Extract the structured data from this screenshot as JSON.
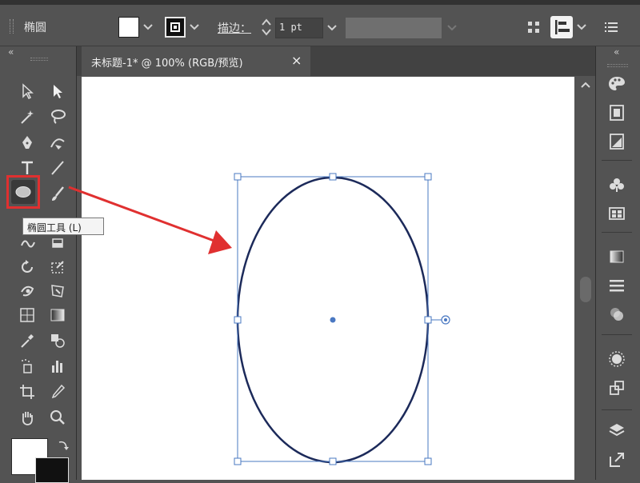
{
  "control_bar": {
    "object_type": "椭圆",
    "fill_color": "#ffffff",
    "stroke_label": "描边：",
    "stroke_weight": "1 pt",
    "icons": [
      "fill-swatch",
      "stroke-swatch",
      "stroke-weight-stepper",
      "align-grid-icon",
      "align-left-icon",
      "menu-icon"
    ]
  },
  "document_tab": {
    "title": "未标题-1* @ 100% (RGB/预览)",
    "close_glyph": "×"
  },
  "panel_collapse_glyph": "«",
  "tooltip": {
    "text": "椭圆工具 (L)"
  },
  "colors": {
    "ui_background": "#535353",
    "tab_bar": "#424242",
    "artboard": "#ffffff",
    "selection_blue": "#4a78c2",
    "ellipse_stroke": "#1c2a5a",
    "highlight_red": "#e03030"
  },
  "tools_left": [
    "selection-tool-icon",
    "direct-selection-tool-icon",
    "magic-wand-tool-icon",
    "lasso-tool-icon",
    "pen-tool-icon",
    "curvature-tool-icon",
    "type-tool-icon",
    "line-segment-tool-icon",
    "ellipse-tool-icon",
    "paintbrush-tool-icon",
    "shaper-tool-icon",
    "eraser-tool-icon",
    "rotate-tool-icon",
    "scale-tool-icon",
    "warp-tool-icon",
    "free-transform-tool-icon",
    "shape-builder-tool-icon",
    "perspective-grid-tool-icon",
    "mesh-tool-icon",
    "gradient-tool-icon",
    "eyedropper-tool-icon",
    "blend-tool-icon",
    "symbol-sprayer-tool-icon",
    "column-graph-tool-icon",
    "artboard-tool-icon",
    "slice-tool-icon",
    "hand-tool-icon",
    "zoom-tool-icon"
  ],
  "panels_right": [
    "color-palette-icon",
    "color-guide-icon",
    "swatches-icon",
    "symbols-icon",
    "libraries-icon",
    "gradient-icon",
    "stroke-icon",
    "transparency-icon",
    "appearance-icon",
    "graphic-styles-icon",
    "layers-icon",
    "export-icon"
  ]
}
